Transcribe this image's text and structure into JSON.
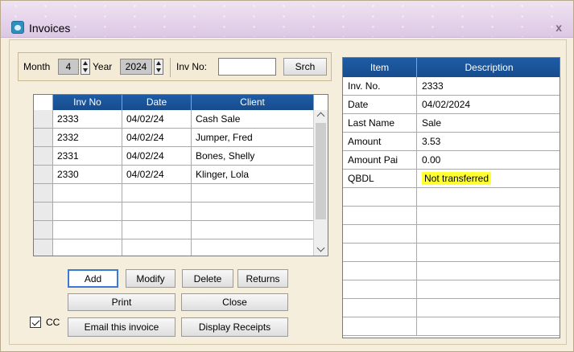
{
  "window": {
    "title": "Invoices",
    "close_glyph": "x"
  },
  "filter": {
    "month_label": "Month",
    "month_value": "4",
    "year_label": "Year",
    "year_value": "2024",
    "inv_no_label": "Inv No:",
    "inv_no_value": "",
    "search_button": "Srch"
  },
  "invoice_grid": {
    "columns": [
      "Inv No",
      "Date",
      "Client"
    ],
    "rows": [
      [
        "2333",
        "04/02/24",
        "Cash Sale"
      ],
      [
        "2332",
        "04/02/24",
        "Jumper, Fred"
      ],
      [
        "2331",
        "04/02/24",
        "Bones, Shelly"
      ],
      [
        "2330",
        "04/02/24",
        "Klinger, Lola"
      ]
    ]
  },
  "details": {
    "columns": [
      "Item",
      "Description"
    ],
    "rows": [
      [
        "Inv. No.",
        "2333"
      ],
      [
        "Date",
        "04/02/2024"
      ],
      [
        "Last Name",
        "Sale"
      ],
      [
        "Amount",
        "3.53"
      ],
      [
        "Amount Pai",
        "0.00"
      ],
      [
        "QBDL",
        "Not transferred"
      ]
    ],
    "highlight_color": "#ffff33"
  },
  "buttons": {
    "add": "Add",
    "modify": "Modify",
    "delete": "Delete",
    "returns": "Returns",
    "print": "Print",
    "close": "Close",
    "email": "Email this invoice",
    "display_receipts": "Display Receipts"
  },
  "cc": {
    "label": "CC",
    "checked": true
  },
  "colors": {
    "header_blue": "#1e5ca6",
    "background": "#f6eedd",
    "titlebar": "#e4d2ea"
  }
}
